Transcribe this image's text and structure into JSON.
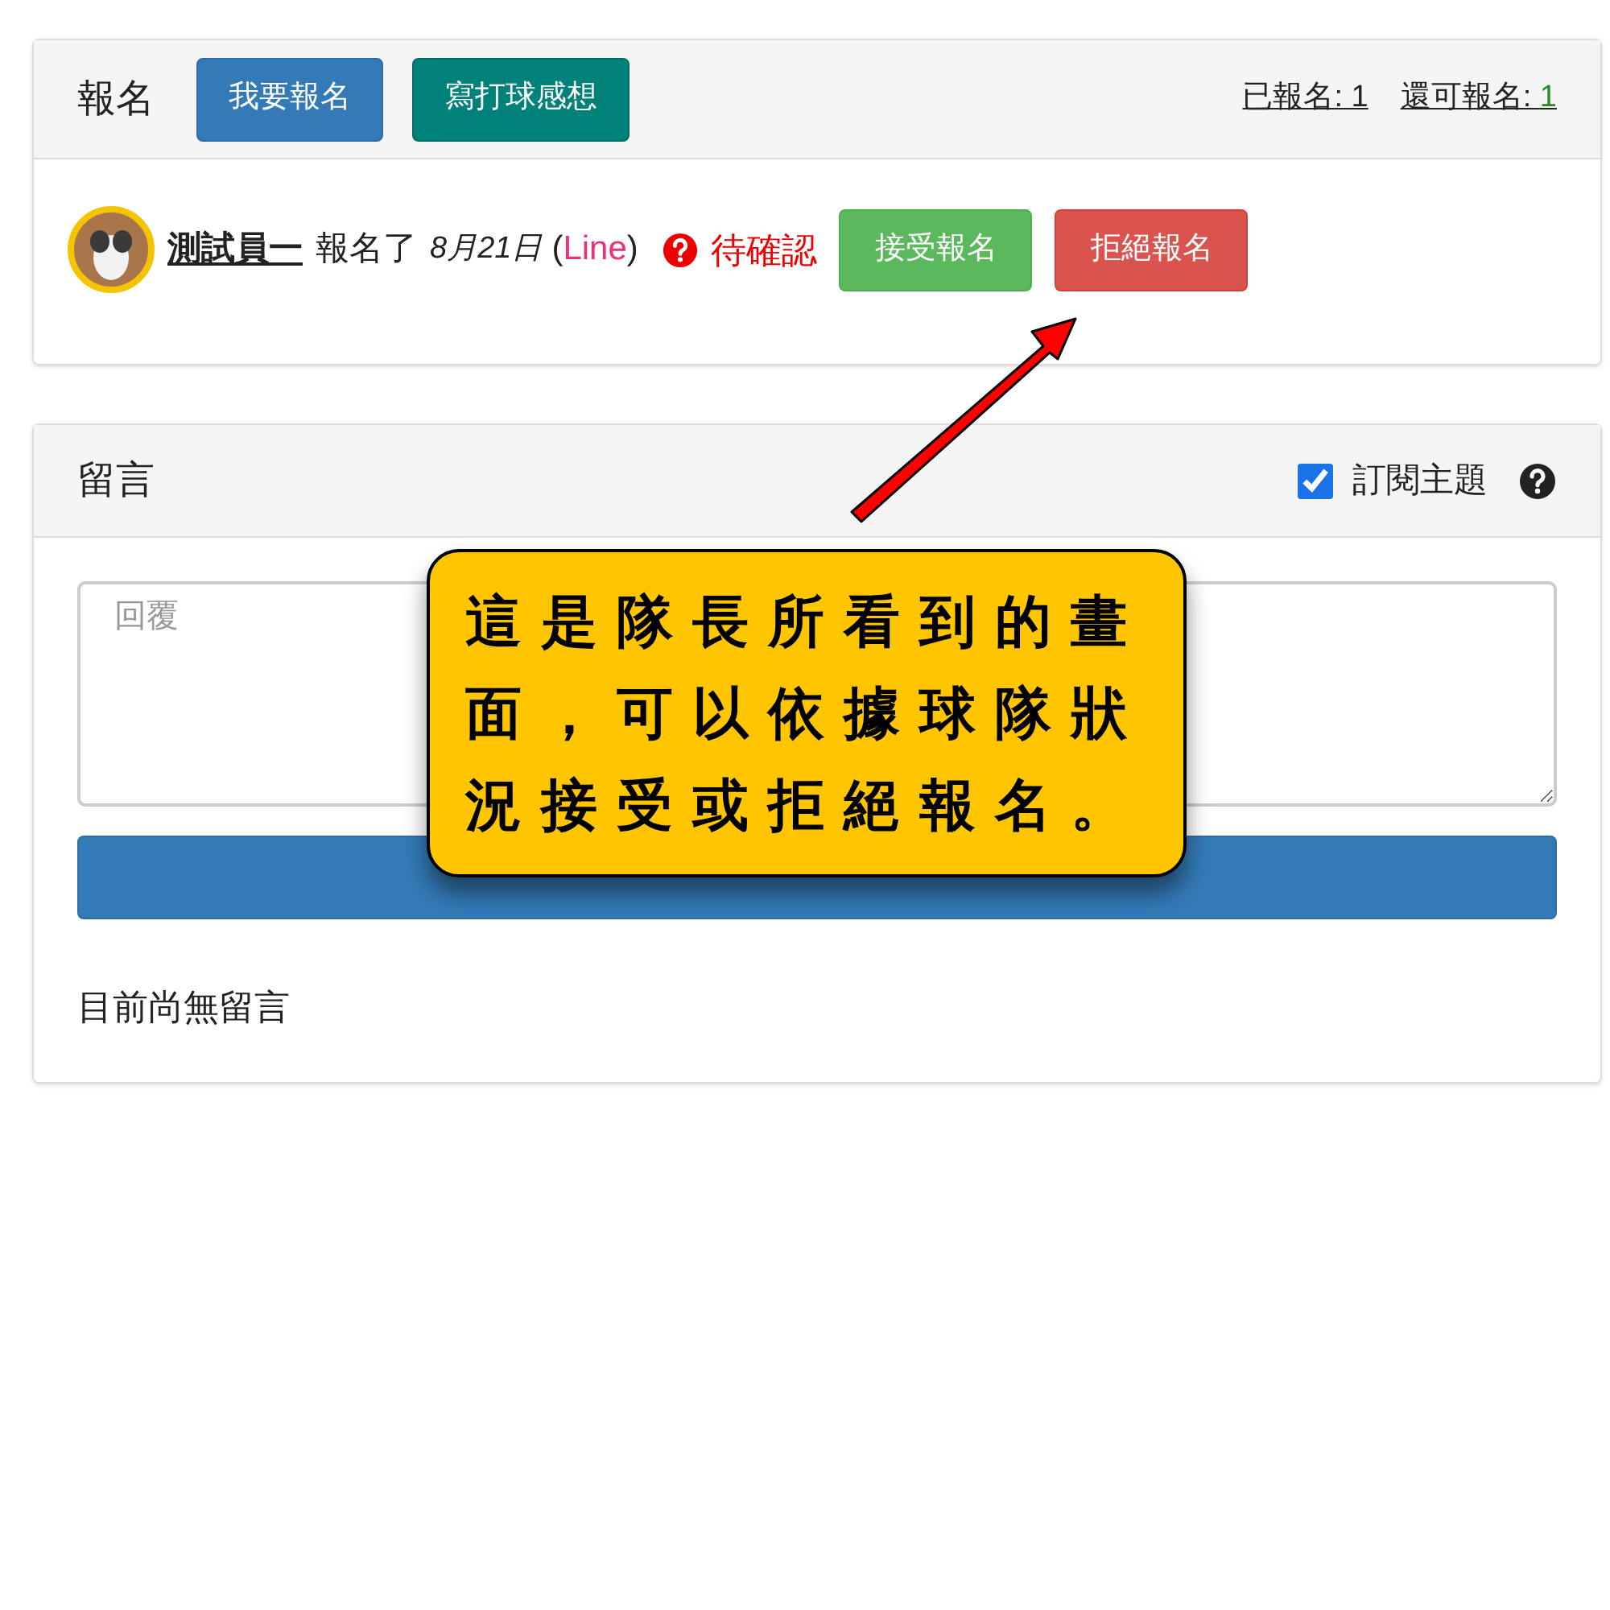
{
  "signup": {
    "title": "報名",
    "buttons": [
      {
        "label": "我要報名",
        "kind": "primary"
      },
      {
        "label": "寫打球感想",
        "kind": "teal"
      }
    ],
    "stats": {
      "registered_label": "已報名: 1",
      "remaining_label": "還可報名: ",
      "remaining_value": "1"
    },
    "entries": [
      {
        "name": "測試員一",
        "action": "報名了",
        "date": "8月21日",
        "paren_open": "(",
        "source": "Line",
        "paren_close": ")",
        "status": "待確認",
        "actions": [
          {
            "label": "接受報名",
            "kind": "accept"
          },
          {
            "label": "拒絕報名",
            "kind": "reject"
          }
        ]
      }
    ]
  },
  "comments": {
    "title": "留言",
    "subscribe": {
      "label": "訂閱主題",
      "checked": true
    },
    "reply": {
      "placeholder": "回覆"
    },
    "empty": "目前尚無留言"
  },
  "callout": {
    "text": "這是隊長所看到的畫面，可以依據球隊狀況接受或拒絕報名。"
  }
}
